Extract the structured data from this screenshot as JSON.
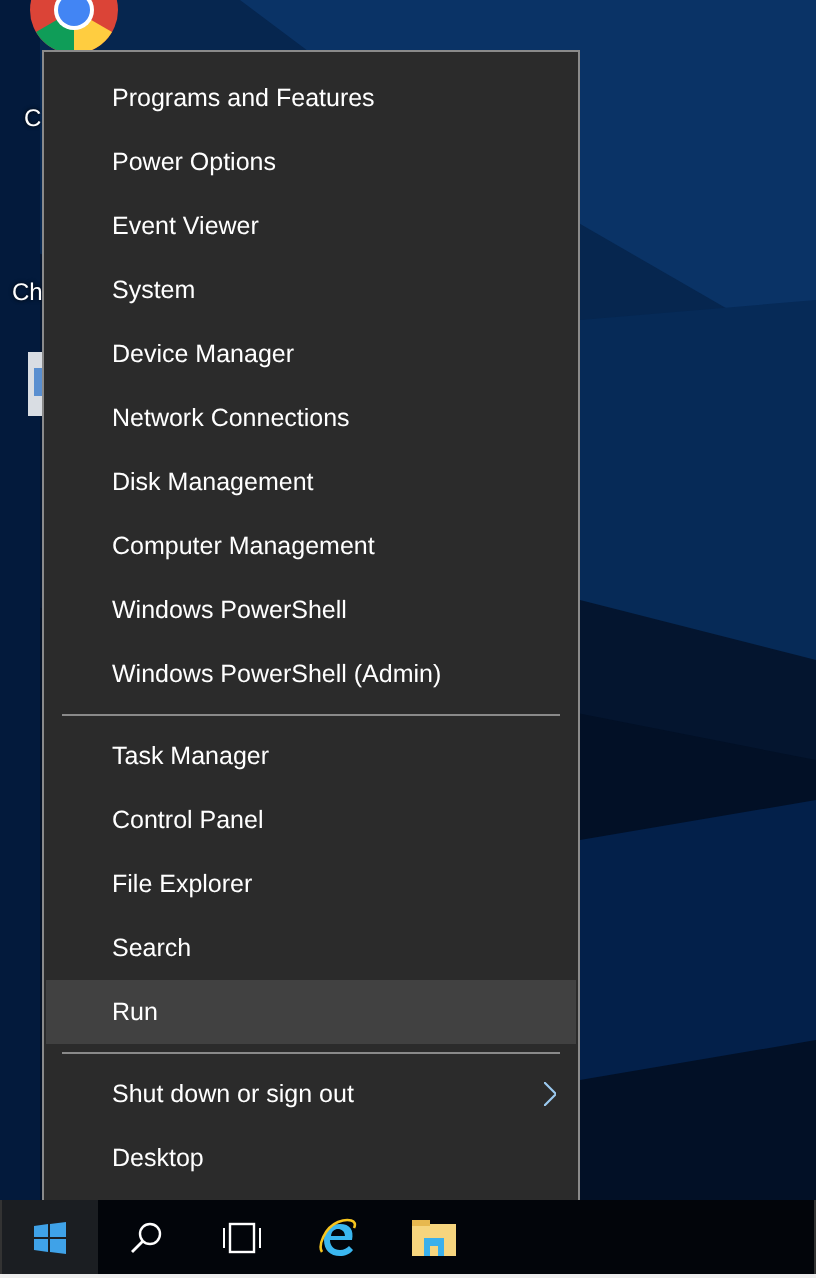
{
  "desktop_icons": [
    {
      "kind": "chrome",
      "label": "C"
    },
    {
      "kind": "file",
      "label": "Ch"
    }
  ],
  "context_menu": {
    "groups": [
      [
        {
          "label": "Programs and Features",
          "selected": false,
          "has_submenu": false
        },
        {
          "label": "Power Options",
          "selected": false,
          "has_submenu": false
        },
        {
          "label": "Event Viewer",
          "selected": false,
          "has_submenu": false
        },
        {
          "label": "System",
          "selected": false,
          "has_submenu": false
        },
        {
          "label": "Device Manager",
          "selected": false,
          "has_submenu": false
        },
        {
          "label": "Network Connections",
          "selected": false,
          "has_submenu": false
        },
        {
          "label": "Disk Management",
          "selected": false,
          "has_submenu": false
        },
        {
          "label": "Computer Management",
          "selected": false,
          "has_submenu": false
        },
        {
          "label": "Windows PowerShell",
          "selected": false,
          "has_submenu": false
        },
        {
          "label": "Windows PowerShell (Admin)",
          "selected": false,
          "has_submenu": false
        }
      ],
      [
        {
          "label": "Task Manager",
          "selected": false,
          "has_submenu": false
        },
        {
          "label": "Control Panel",
          "selected": false,
          "has_submenu": false
        },
        {
          "label": "File Explorer",
          "selected": false,
          "has_submenu": false
        },
        {
          "label": "Search",
          "selected": false,
          "has_submenu": false
        },
        {
          "label": "Run",
          "selected": true,
          "has_submenu": false
        }
      ],
      [
        {
          "label": "Shut down or sign out",
          "selected": false,
          "has_submenu": true
        },
        {
          "label": "Desktop",
          "selected": false,
          "has_submenu": false
        }
      ]
    ]
  },
  "taskbar": {
    "items": [
      {
        "kind": "start",
        "selected": true
      },
      {
        "kind": "search",
        "selected": false
      },
      {
        "kind": "task-view",
        "selected": false
      },
      {
        "kind": "browser",
        "selected": false
      },
      {
        "kind": "folder",
        "selected": false
      }
    ]
  }
}
